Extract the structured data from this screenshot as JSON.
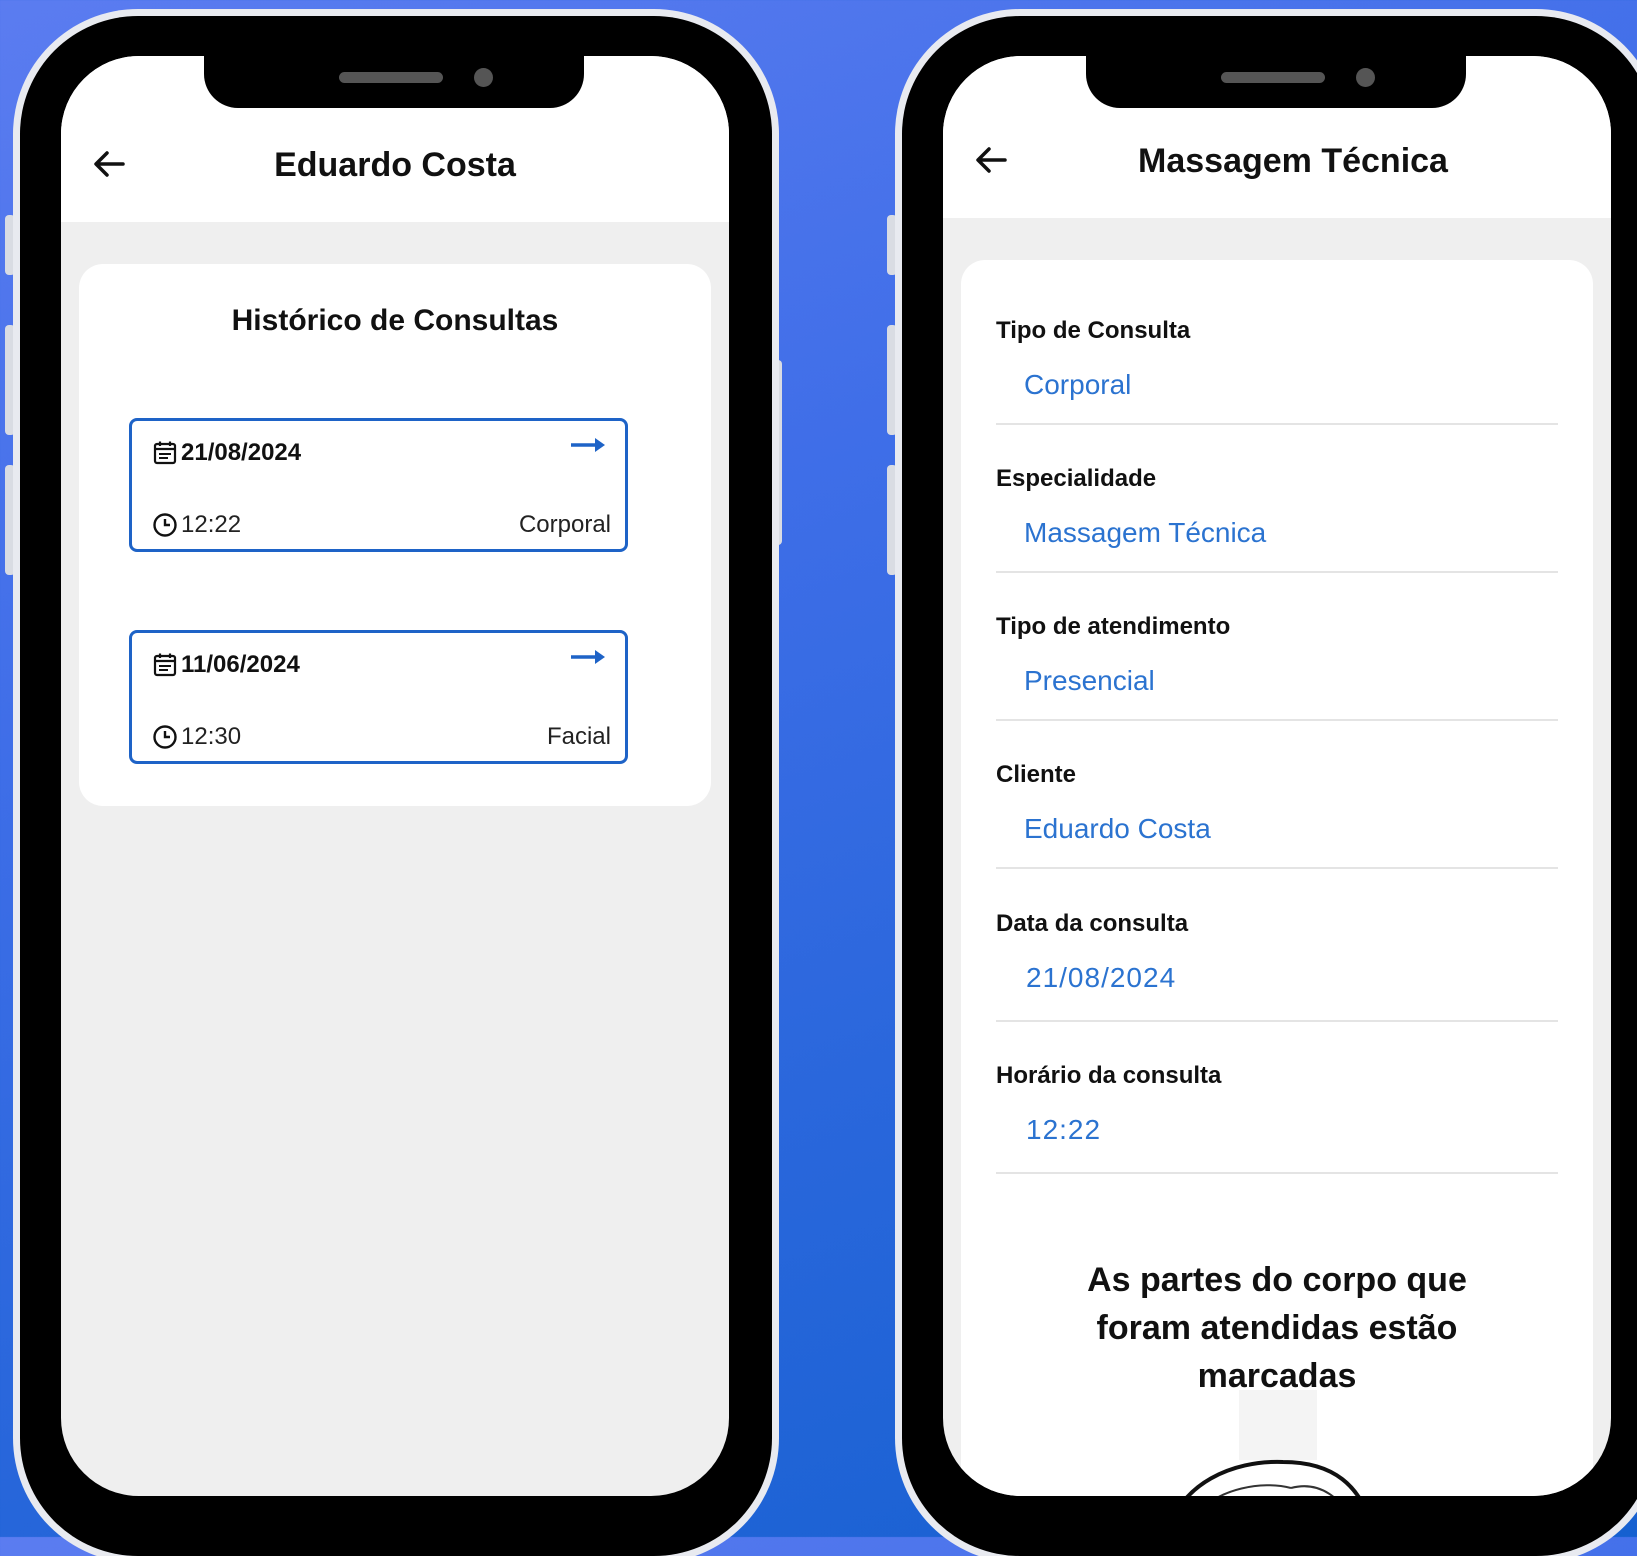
{
  "left_phone": {
    "appbar": {
      "title": "Eduardo Costa"
    },
    "history": {
      "title": "Histórico de Consultas",
      "items": [
        {
          "date": "21/08/2024",
          "time": "12:22",
          "type": "Corporal"
        },
        {
          "date": "11/06/2024",
          "time": "12:30",
          "type": "Facial"
        }
      ]
    }
  },
  "right_phone": {
    "appbar": {
      "title": "Massagem Técnica"
    },
    "fields": [
      {
        "label": "Tipo de Consulta",
        "value": "Corporal"
      },
      {
        "label": "Especialidade",
        "value": "Massagem Técnica"
      },
      {
        "label": "Tipo de atendimento",
        "value": "Presencial"
      },
      {
        "label": "Cliente",
        "value": "Eduardo Costa"
      },
      {
        "label": "Data da consulta",
        "value": "21/08/2024"
      },
      {
        "label": "Horário da consulta",
        "value": "12:22"
      }
    ],
    "body_parts_title": "As partes do corpo que foram atendidas estão marcadas"
  },
  "colors": {
    "accent": "#2b73d0",
    "card_border": "#1e63c7",
    "background_top": "#5b7cf0",
    "background_bottom": "#1560d0"
  },
  "icons": [
    "back-arrow-icon",
    "calendar-icon",
    "clock-icon",
    "arrow-right-icon",
    "body-diagram"
  ]
}
